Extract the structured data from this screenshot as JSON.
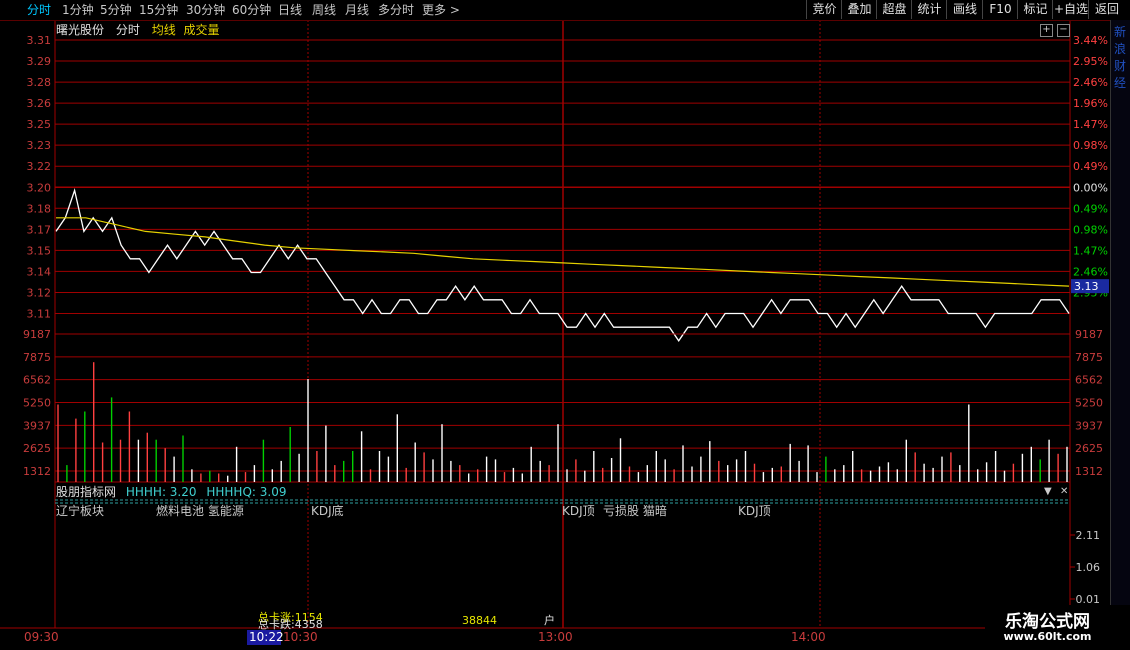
{
  "toolbar": {
    "tabs": [
      "分时",
      "1分钟",
      "5分钟",
      "15分钟",
      "30分钟",
      "60分钟",
      "日线",
      "周线",
      "月线",
      "多分时",
      "更多"
    ],
    "active_tab": "分时",
    "right_buttons": [
      "竞价",
      "叠加",
      "超盘",
      "统计",
      "画线",
      "F10",
      "标记",
      "+自选",
      "返回"
    ]
  },
  "stock": {
    "name": "曙光股份",
    "mode": "分时",
    "avg_label": "均线",
    "vol_label": "成交量",
    "current_price": "3.13"
  },
  "colors": {
    "price_line": "#ffffff",
    "avg_line": "#e6d200",
    "grid": "#a00000",
    "up_bar": "#ff4040",
    "down_bar": "#00d000",
    "neutral_bar": "#ffffff",
    "price_axis": "#c83c3c",
    "pct_up": "#ff4040",
    "pct_down": "#00d000"
  },
  "chart_data": {
    "type": "line",
    "title": "",
    "price_ticks": [
      "3.31",
      "3.29",
      "3.28",
      "3.26",
      "3.25",
      "3.23",
      "3.22",
      "3.20",
      "3.18",
      "3.17",
      "3.15",
      "3.14",
      "3.12",
      "3.11"
    ],
    "pct_ticks": [
      "3.44%",
      "2.95%",
      "2.46%",
      "1.96%",
      "1.47%",
      "0.98%",
      "0.49%",
      "0.00%",
      "0.49%",
      "0.98%",
      "1.47%",
      "2.46%",
      "2.95%"
    ],
    "price_range": [
      3.11,
      3.31
    ],
    "prev_close": 3.2,
    "time_labels": [
      "09:30",
      "10:30",
      "13:00",
      "14:00"
    ],
    "price_series": [
      3.17,
      3.18,
      3.2,
      3.17,
      3.18,
      3.17,
      3.18,
      3.16,
      3.15,
      3.15,
      3.14,
      3.15,
      3.16,
      3.15,
      3.16,
      3.17,
      3.16,
      3.17,
      3.16,
      3.15,
      3.15,
      3.14,
      3.14,
      3.15,
      3.16,
      3.15,
      3.16,
      3.15,
      3.15,
      3.14,
      3.13,
      3.12,
      3.12,
      3.11,
      3.12,
      3.11,
      3.11,
      3.12,
      3.12,
      3.11,
      3.11,
      3.12,
      3.12,
      3.13,
      3.12,
      3.13,
      3.12,
      3.12,
      3.12,
      3.11,
      3.11,
      3.12,
      3.11,
      3.11,
      3.11,
      3.1,
      3.1,
      3.11,
      3.1,
      3.11,
      3.1,
      3.1,
      3.1,
      3.1,
      3.1,
      3.1,
      3.1,
      3.09,
      3.1,
      3.1,
      3.11,
      3.1,
      3.11,
      3.11,
      3.11,
      3.1,
      3.11,
      3.12,
      3.11,
      3.12,
      3.12,
      3.12,
      3.11,
      3.11,
      3.1,
      3.11,
      3.1,
      3.11,
      3.12,
      3.11,
      3.12,
      3.13,
      3.12,
      3.12,
      3.12,
      3.12,
      3.11,
      3.11,
      3.11,
      3.11,
      3.1,
      3.11,
      3.11,
      3.11,
      3.11,
      3.11,
      3.12,
      3.12,
      3.12,
      3.11
    ],
    "avg_series": [
      3.18,
      3.18,
      3.175,
      3.17,
      3.168,
      3.166,
      3.163,
      3.16,
      3.158,
      3.157,
      3.156,
      3.155,
      3.154,
      3.152,
      3.15,
      3.149,
      3.148,
      3.147,
      3.146,
      3.145,
      3.144,
      3.143,
      3.142,
      3.141,
      3.14,
      3.139,
      3.138,
      3.137,
      3.136,
      3.135,
      3.134,
      3.133,
      3.132,
      3.131,
      3.13
    ],
    "volume_ticks": [
      "9187",
      "7875",
      "6562",
      "5250",
      "3937",
      "2625",
      "1312"
    ],
    "volume_range": [
      0,
      10500
    ],
    "volumes": [
      5500,
      1200,
      4500,
      5000,
      8500,
      2800,
      6000,
      3000,
      5000,
      3000,
      3500,
      3000,
      2400,
      1800,
      3300,
      900,
      600,
      800,
      600,
      450,
      2500,
      700,
      1200,
      3000,
      900,
      1500,
      3900,
      2000,
      7300,
      2200,
      4000,
      1200,
      1500,
      2200,
      3600,
      900,
      2200,
      1800,
      4800,
      1000,
      2800,
      2100,
      1600,
      4100,
      1500,
      1200,
      600,
      900,
      1800,
      1600,
      700,
      1000,
      600,
      2500,
      1500,
      1200,
      4100,
      900,
      1600,
      800,
      2200,
      1000,
      1700,
      3100,
      1100,
      700,
      1200,
      2200,
      1600,
      900,
      2600,
      1100,
      1800,
      2900,
      1500,
      1200,
      1600,
      2200,
      1300,
      700,
      1000,
      1100,
      2700,
      1500,
      2600,
      700,
      1800,
      900,
      1200,
      2200,
      900,
      800,
      1100,
      1400,
      900,
      3000,
      2100,
      1300,
      1000,
      1800,
      2100,
      1200,
      5500,
      900,
      1400,
      2200,
      800,
      1300,
      2000,
      2500,
      1600,
      3000,
      2000,
      2500
    ],
    "volume_colors": [
      "u",
      "d",
      "u",
      "d",
      "u",
      "u",
      "d",
      "u",
      "u",
      "n",
      "u",
      "d",
      "u",
      "n",
      "d",
      "n",
      "u",
      "d",
      "u",
      "n",
      "n",
      "u",
      "n",
      "d",
      "n",
      "n",
      "d",
      "n",
      "n",
      "u",
      "n",
      "u",
      "d",
      "d",
      "n",
      "u",
      "n",
      "n",
      "n",
      "u",
      "n",
      "u",
      "n",
      "n",
      "n",
      "u",
      "n",
      "u",
      "n",
      "n",
      "u",
      "n",
      "n",
      "n",
      "n",
      "u",
      "n",
      "n",
      "u",
      "n",
      "n",
      "u",
      "n",
      "n",
      "u",
      "n",
      "n",
      "n",
      "n",
      "u",
      "n",
      "n",
      "n",
      "n",
      "u",
      "n",
      "n",
      "n",
      "u",
      "n",
      "n",
      "u",
      "n",
      "n",
      "n",
      "n",
      "d",
      "n",
      "n",
      "n",
      "u",
      "n",
      "n",
      "n",
      "n",
      "n",
      "u",
      "n",
      "n",
      "n",
      "u",
      "n",
      "n",
      "n",
      "n",
      "n",
      "n",
      "u",
      "n",
      "n",
      "d",
      "n",
      "u"
    ],
    "indicator_ticks": [
      "2.11",
      "1.06",
      "0.01"
    ],
    "y_unit_pct": "%"
  },
  "indicator": {
    "name": "股朋指标网",
    "hhhh_label": "HHHH: 3.20",
    "hhhhq_label": "HHHHQ: 3.09",
    "tags": [
      {
        "text": "辽宁板块",
        "color": "#ffffff"
      },
      {
        "text": "燃料电池 氢能源",
        "color": "#4f8bff"
      },
      {
        "text": "KDJ底",
        "color": "#ff6ad5"
      },
      {
        "text": "KDJ顶",
        "color": "#ff6ad5"
      },
      {
        "text": "亏损股 猫暗",
        "color": "#ff9a30"
      },
      {
        "text": "KDJ顶",
        "color": "#4dd0ff"
      }
    ],
    "stat1": "总卡涨:1154",
    "stat2": "总卡跌:4358",
    "stat3": "38844",
    "stat4": "户",
    "selected_time": "10:22"
  },
  "sidebar": {
    "text": "新浪财经"
  },
  "watermark": {
    "title": "乐淘公式网",
    "url": "www.60lt.com"
  }
}
